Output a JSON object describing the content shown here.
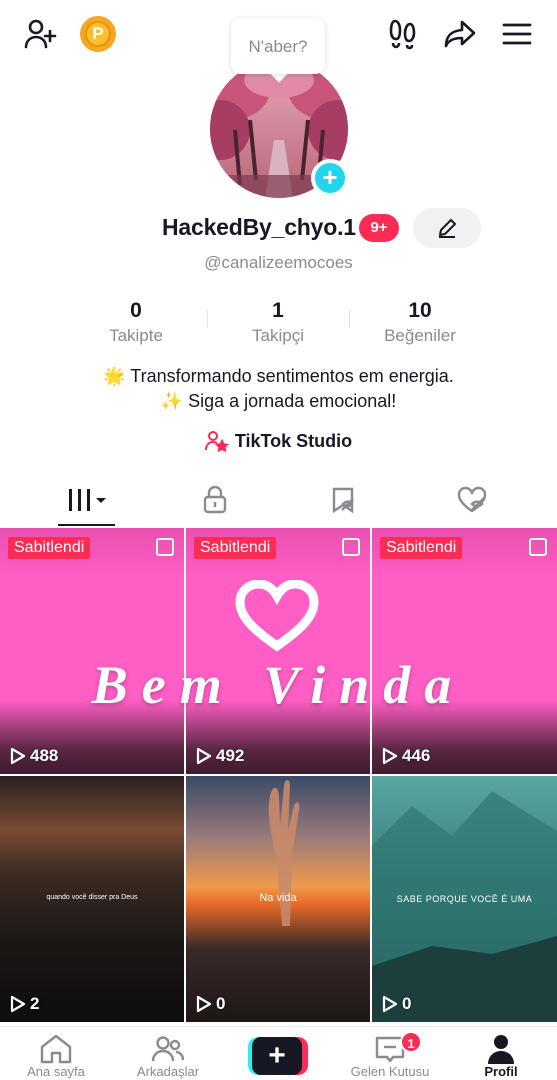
{
  "header": {
    "bubble_text": "N'aber?",
    "coin_letter": "P"
  },
  "profile": {
    "display_name": "HackedBy_chyo.1",
    "notification_badge": "9+",
    "username": "@canalizeemocoes",
    "stats": [
      {
        "value": "0",
        "label": "Takipte"
      },
      {
        "value": "1",
        "label": "Takipçi"
      },
      {
        "value": "10",
        "label": "Beğeniler"
      }
    ],
    "bio_line1": "🌟 Transformando sentimentos em energia.",
    "bio_line2": "✨ Siga a jornada emocional!",
    "studio_label": "TikTok Studio"
  },
  "grid": {
    "pinned_label": "Sabitlendi",
    "banner_text": "Bem Vinda",
    "videos": [
      {
        "views": "488",
        "caption": ""
      },
      {
        "views": "492",
        "caption": ""
      },
      {
        "views": "446",
        "caption": ""
      },
      {
        "views": "2",
        "caption": "quando você disser pra Deus"
      },
      {
        "views": "0",
        "caption": "Na vida"
      },
      {
        "views": "0",
        "caption": "SABE PORQUE VOCÊ É UMA"
      }
    ]
  },
  "nav": {
    "items": [
      {
        "label": "Ana sayfa"
      },
      {
        "label": "Arkadaşlar"
      },
      {
        "label": ""
      },
      {
        "label": "Gelen Kutusu",
        "badge": "1"
      },
      {
        "label": "Profil"
      }
    ]
  },
  "colors": {
    "accent": "#fe2c55",
    "cyan": "#20d5ec",
    "pink_tile": "#ff5ec4",
    "text": "#161823",
    "muted": "#8a8b91"
  }
}
